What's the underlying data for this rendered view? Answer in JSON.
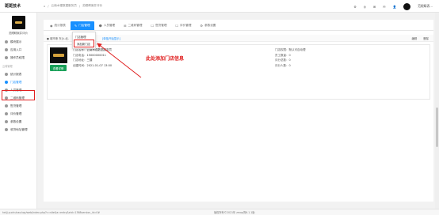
{
  "topbar": {
    "brand": "斑斑技术",
    "breadcrumb": [
      "⌂",
      "/",
      "云南木槿数据服务员",
      "/",
      "范眼睛案并评价"
    ],
    "right_icons": [
      "⚙",
      "◎",
      "⊞",
      "✉",
      "👤"
    ],
    "user_name": "范眼睛表..."
  },
  "sidebar": {
    "shop_name": "范眼睛案并评价",
    "group_1": [
      {
        "label": "模块展示"
      },
      {
        "label": "应用入口"
      },
      {
        "label": "操作员权限"
      }
    ],
    "group_title": "云端管理",
    "group_2": [
      {
        "label": "统计报表"
      },
      {
        "label": "门店管理"
      },
      {
        "label": "人员管理"
      },
      {
        "label": "二维码管理"
      },
      {
        "label": "售货管理"
      },
      {
        "label": "评价管理"
      },
      {
        "label": "参数设置"
      },
      {
        "label": "收货地址管理"
      }
    ]
  },
  "tabs": [
    {
      "icon": "◉",
      "label": "统计报表"
    },
    {
      "icon": "✎",
      "label": "门店管理"
    },
    {
      "icon": "☻",
      "label": "人员管理"
    },
    {
      "icon": "⊞",
      "label": "二维码管理"
    },
    {
      "icon": "☐",
      "label": "售货管理"
    },
    {
      "icon": "☐",
      "label": "评价管理"
    },
    {
      "icon": "⚙",
      "label": "参数设置"
    }
  ],
  "dropdown": {
    "items": [
      "门店管理",
      "添加新门店"
    ]
  },
  "subbar": {
    "left": "● 城市条 东沙-北-",
    "link": "[单独开始显示]",
    "edit": "编辑",
    "delete": "删除"
  },
  "store": {
    "button": "查看详情",
    "name_label": "门店名称：",
    "name_value": "云南木槿数据服务员",
    "phone_label": "门店电话：",
    "phone_value": "15000000011",
    "contact_label": "门店地址：",
    "contact_value": "三楼",
    "time_label": "创建时间：",
    "time_value": "2021-01-07 13:00",
    "right": [
      {
        "label": "门店权限：",
        "value": "默认可自动理"
      },
      {
        "label": "员工数量：",
        "value": "0"
      },
      {
        "label": "评分总数：",
        "value": "0"
      },
      {
        "label": "评分人数：",
        "value": "0"
      }
    ]
  },
  "annotation": "此处添加门店信息",
  "colors": {
    "accent": "#1890ff",
    "annotation": "#e02020",
    "button": "#18a058"
  },
  "status": {
    "url": "heljj.yuchuhao.top/web/index.php?c=site&a=entry&eid=1368version_id=0#",
    "copy": "版权所有©2021年 zmop简6.1.1版"
  }
}
